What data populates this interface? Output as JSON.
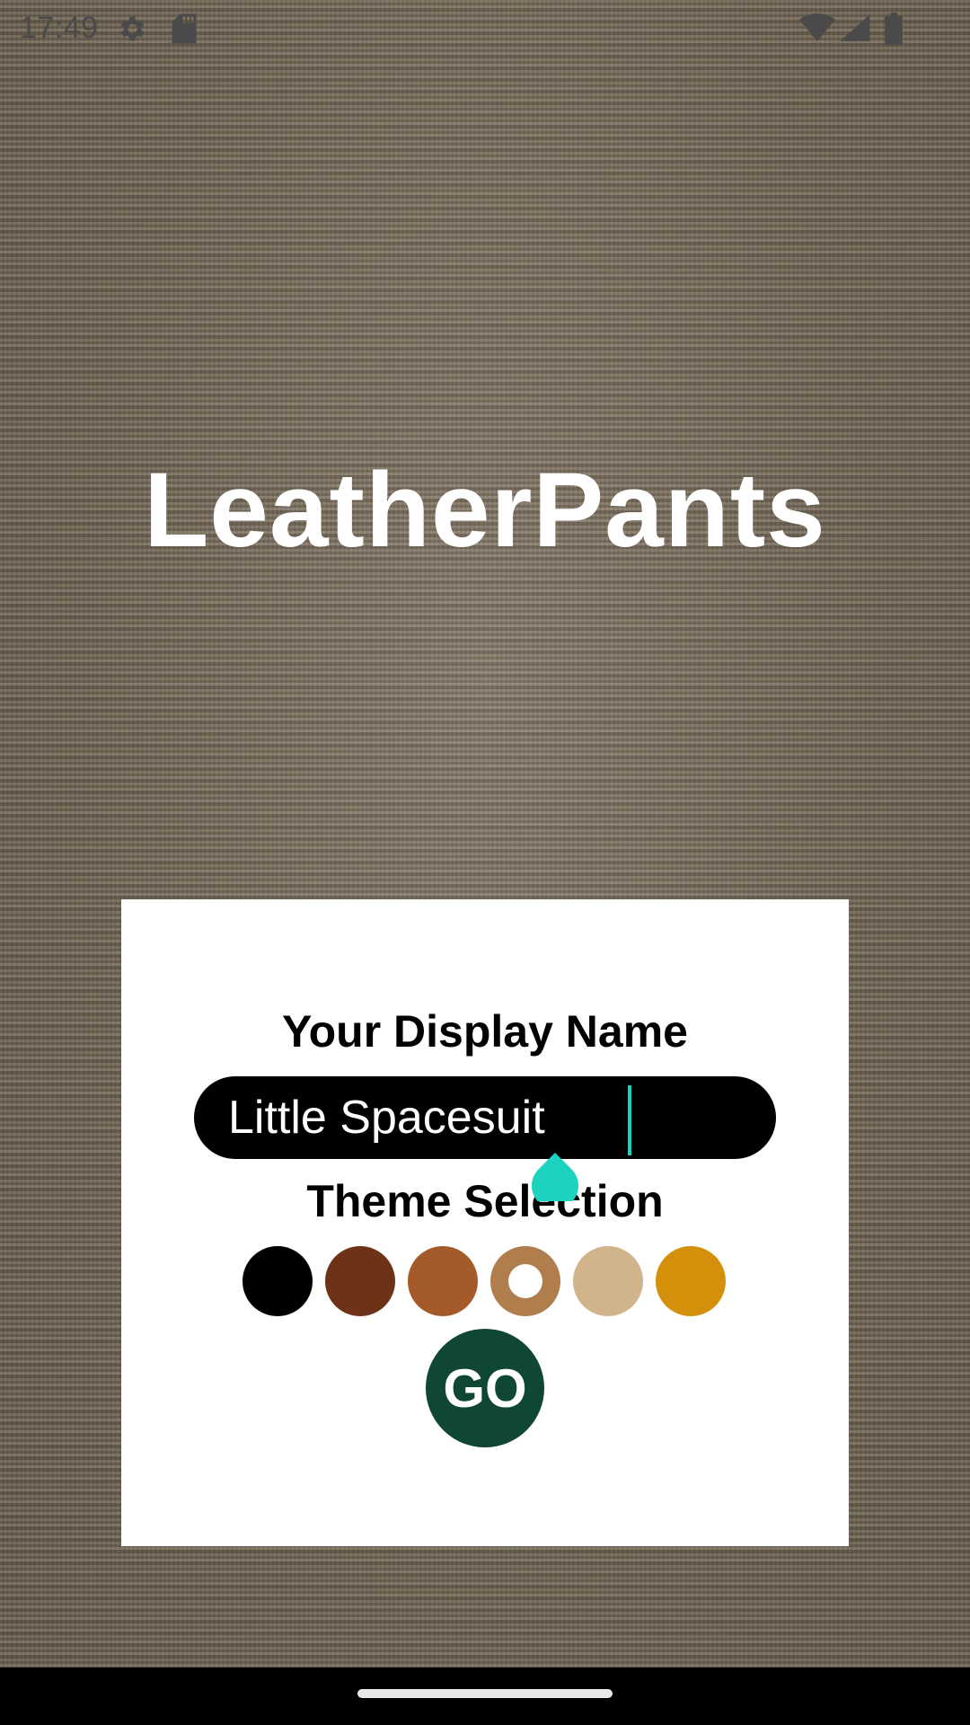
{
  "status_bar": {
    "time": "17:49",
    "icons": [
      "gear-icon",
      "sd-card-icon",
      "wifi-icon",
      "cell-signal-icon",
      "battery-icon"
    ]
  },
  "app": {
    "title": "LeatherPants"
  },
  "form": {
    "display_name_label": "Your Display Name",
    "display_name_value": "Little Spacesuit",
    "theme_label": "Theme Selection",
    "go_label": "GO",
    "themes": [
      {
        "color": "#000000",
        "selected": false
      },
      {
        "color": "#6e3219",
        "selected": false
      },
      {
        "color": "#a55a2a",
        "selected": false
      },
      {
        "color": "#b07d4d",
        "selected": true
      },
      {
        "color": "#d2b48c",
        "selected": false
      },
      {
        "color": "#d4900a",
        "selected": false
      }
    ]
  },
  "colors": {
    "accent_cursor": "#1bd3bf",
    "go_button": "#0f4734",
    "card": "#ffffff"
  }
}
